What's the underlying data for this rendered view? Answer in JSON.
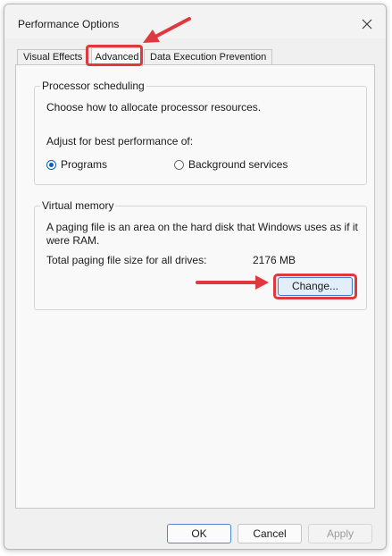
{
  "window": {
    "title": "Performance Options"
  },
  "tabs": [
    {
      "label": "Visual Effects"
    },
    {
      "label": "Advanced"
    },
    {
      "label": "Data Execution Prevention"
    }
  ],
  "processor_scheduling": {
    "legend": "Processor scheduling",
    "description": "Choose how to allocate processor resources.",
    "adjust_label": "Adjust for best performance of:",
    "options": [
      {
        "label": "Programs",
        "checked": true
      },
      {
        "label": "Background services",
        "checked": false
      }
    ]
  },
  "virtual_memory": {
    "legend": "Virtual memory",
    "description_line1": "A paging file is an area on the hard disk that Windows uses as if it",
    "description_line2": "were RAM.",
    "total_label": "Total paging file size for all drives:",
    "total_value": "2176 MB",
    "change_button": "Change..."
  },
  "footer": {
    "ok": "OK",
    "cancel": "Cancel",
    "apply": "Apply"
  },
  "colors": {
    "annotation": "#e0383e",
    "accent": "#0a5fb4"
  }
}
